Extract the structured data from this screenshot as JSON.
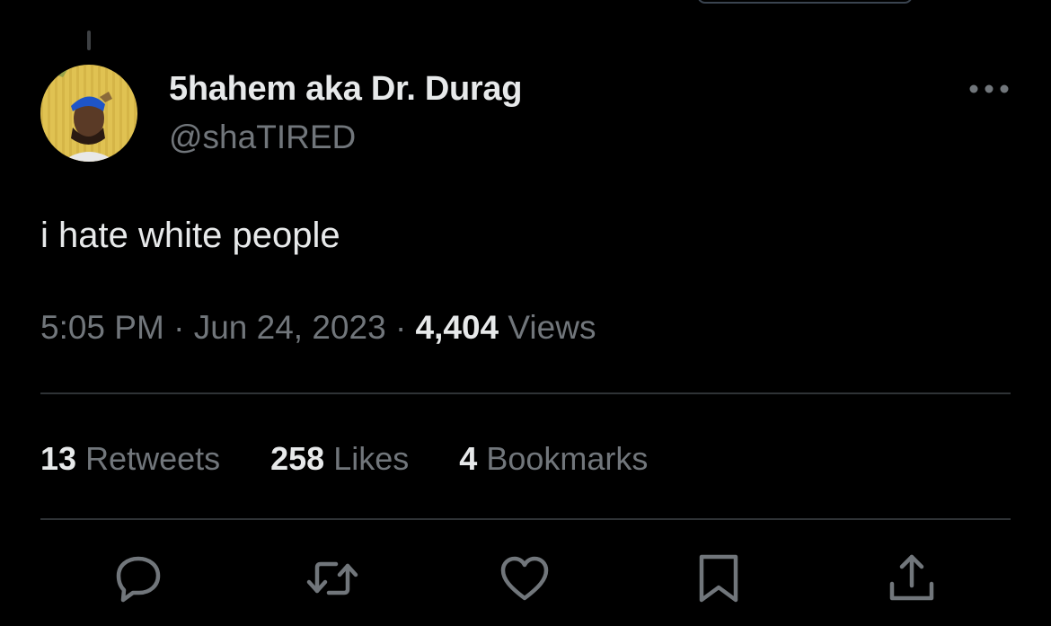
{
  "tweet": {
    "author": {
      "display_name": "5hahem aka Dr. Durag",
      "handle": "@shaTIRED"
    },
    "text": "i hate white people",
    "meta": {
      "time": "5:05 PM",
      "separator": "·",
      "date": "Jun 24, 2023",
      "views_count": "4,404",
      "views_label": "Views"
    },
    "stats": {
      "retweets_count": "13",
      "retweets_label": "Retweets",
      "likes_count": "258",
      "likes_label": "Likes",
      "bookmarks_count": "4",
      "bookmarks_label": "Bookmarks"
    }
  },
  "icons": {
    "more": "more-horizontal-icon",
    "reply": "reply-icon",
    "retweet": "retweet-icon",
    "like": "heart-icon",
    "bookmark": "bookmark-icon",
    "share": "share-icon"
  },
  "colors": {
    "background": "#000000",
    "primary_text": "#e7e9ea",
    "secondary_text": "#71767b",
    "divider": "#2f3336"
  }
}
